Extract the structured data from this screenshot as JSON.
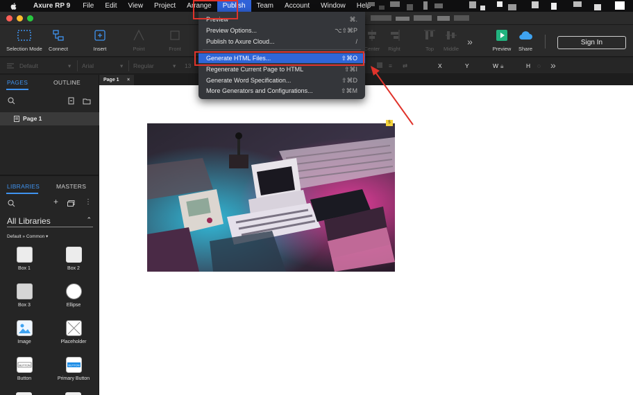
{
  "menubar": {
    "app_name": "Axure RP 9",
    "items": [
      "File",
      "Edit",
      "View",
      "Project",
      "Arrange",
      "Publish",
      "Team",
      "Account",
      "Window",
      "Help"
    ]
  },
  "toolbar": {
    "selection_mode": "Selection Mode",
    "connect": "Connect",
    "insert": "Insert",
    "point": "Point",
    "front": "Front",
    "center": "Center",
    "right": "Right",
    "top": "Top",
    "middle": "Middle",
    "preview": "Preview",
    "share": "Share",
    "sign_in": "Sign In"
  },
  "stylebar": {
    "style": "Default",
    "font": "Arial",
    "weight": "Regular",
    "size": "13",
    "x_label": "X",
    "y_label": "Y",
    "w_label": "W",
    "h_label": "H"
  },
  "pages_panel": {
    "tab_pages": "PAGES",
    "tab_outline": "OUTLINE",
    "page_name": "Page 1"
  },
  "libraries_panel": {
    "tab_libraries": "LIBRARIES",
    "tab_masters": "MASTERS",
    "selected_library": "All Libraries",
    "path": "Default » Common",
    "widgets": [
      "Box 1",
      "Box 2",
      "Box 3",
      "Ellipse",
      "Image",
      "Placeholder",
      "Button",
      "Primary Button"
    ]
  },
  "canvas": {
    "page_tab": "Page 1",
    "badge": "5"
  },
  "publish_menu": {
    "items": [
      {
        "label": "Preview",
        "shortcut": "⌘."
      },
      {
        "label": "Preview Options...",
        "shortcut": "⌥⇧⌘P"
      },
      {
        "label": "Publish to Axure Cloud...",
        "shortcut": "/"
      },
      {
        "label": "Generate HTML Files...",
        "shortcut": "⇧⌘O"
      },
      {
        "label": "Regenerate Current Page to HTML",
        "shortcut": "⇧⌘I"
      },
      {
        "label": "Generate Word Specification...",
        "shortcut": "⇧⌘D"
      },
      {
        "label": "More Generators and Configurations...",
        "shortcut": "⇧⌘M"
      }
    ],
    "highlighted_index": 3
  },
  "colors": {
    "highlight": "#2f66d8",
    "annotation": "#e0332b",
    "accent_tab": "#3f93f0"
  }
}
